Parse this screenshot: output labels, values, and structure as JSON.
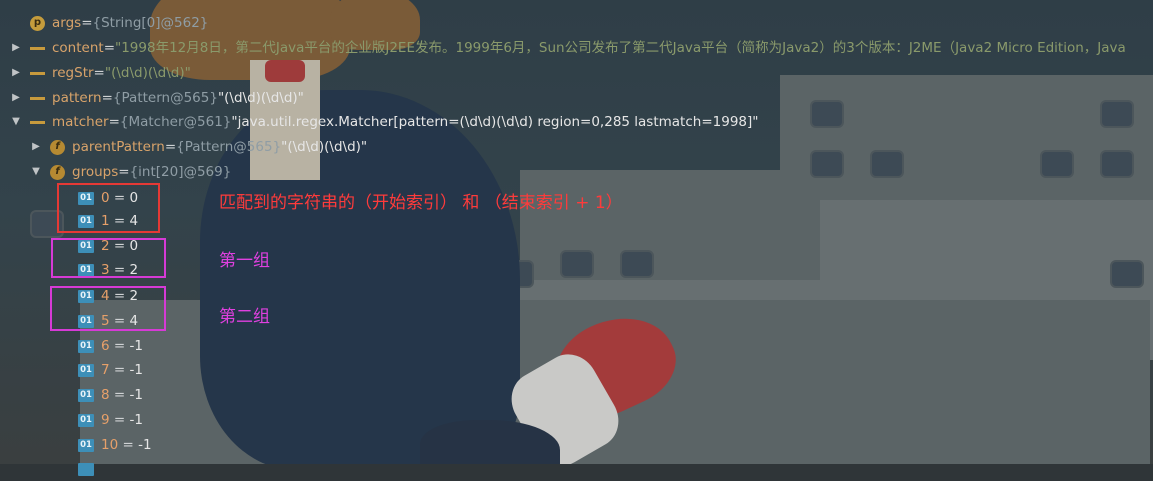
{
  "variables": [
    {
      "name": "args",
      "eq": " = ",
      "type": "{String[0]@562}",
      "value": ""
    },
    {
      "name": "content",
      "eq": " = ",
      "type": "",
      "value": "\"1998年12月8日，第二代Java平台的企业版J2EE发布。1999年6月，Sun公司发布了第二代Java平台（简称为Java2）的3个版本：J2ME（Java2 Micro Edition，Java"
    },
    {
      "name": "regStr",
      "eq": " = ",
      "type": "",
      "value": "\"(\\d\\d)(\\d\\d)\""
    },
    {
      "name": "pattern",
      "eq": " = ",
      "type": "{Pattern@565} ",
      "value": "\"(\\d\\d)(\\d\\d)\""
    },
    {
      "name": "matcher",
      "eq": " = ",
      "type": "{Matcher@561} ",
      "value": "\"java.util.regex.Matcher[pattern=(\\d\\d)(\\d\\d) region=0,285 lastmatch=1998]\""
    },
    {
      "name": "parentPattern",
      "eq": " = ",
      "type": "{Pattern@565} ",
      "value": "\"(\\d\\d)(\\d\\d)\""
    },
    {
      "name": "groups",
      "eq": " = ",
      "type": "{int[20]@569}",
      "value": ""
    }
  ],
  "groups": [
    {
      "index": "0",
      "value": "0"
    },
    {
      "index": "1",
      "value": "4"
    },
    {
      "index": "2",
      "value": "0"
    },
    {
      "index": "3",
      "value": "2"
    },
    {
      "index": "4",
      "value": "2"
    },
    {
      "index": "5",
      "value": "4"
    },
    {
      "index": "6",
      "value": "-1"
    },
    {
      "index": "7",
      "value": "-1"
    },
    {
      "index": "8",
      "value": "-1"
    },
    {
      "index": "9",
      "value": "-1"
    },
    {
      "index": "10",
      "value": "-1"
    }
  ],
  "icons": {
    "param": "p",
    "field": "f",
    "array_element": "01",
    "list": "list-icon"
  },
  "annotations": {
    "match_range": "匹配到的字符串的（开始索引）  和  （结束索引 + 1）",
    "group1": "第一组",
    "group2": "第二组"
  },
  "colors": {
    "red_box": "#e53935",
    "magenta_box": "#d63ad6",
    "name": "#d8a36a",
    "array_icon": "#3d8fb8"
  }
}
